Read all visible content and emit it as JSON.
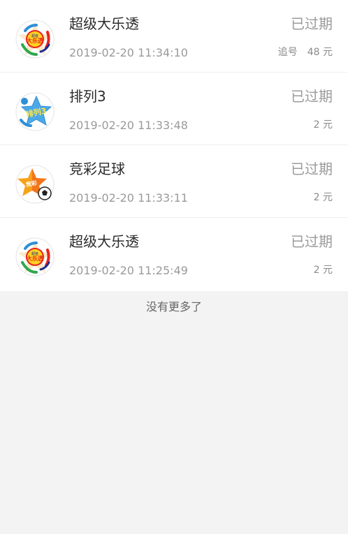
{
  "records": [
    {
      "name": "超级大乐透",
      "logo": "daletou-logo-icon",
      "logo_text": "大乐透",
      "logo_small": "超级",
      "time": "2019-02-20 11:34:10",
      "status": "已过期",
      "tag": "追号",
      "amount": "48 元"
    },
    {
      "name": "排列3",
      "logo": "pailie3-logo-icon",
      "logo_text": "排列3",
      "time": "2019-02-20 11:33:48",
      "status": "已过期",
      "tag": "",
      "amount": "2 元"
    },
    {
      "name": "竞彩足球",
      "logo": "jingcai-football-logo-icon",
      "logo_text": "竞彩",
      "time": "2019-02-20 11:33:11",
      "status": "已过期",
      "tag": "",
      "amount": "2 元"
    },
    {
      "name": "超级大乐透",
      "logo": "daletou-logo-icon",
      "logo_text": "大乐透",
      "logo_small": "超级",
      "time": "2019-02-20 11:25:49",
      "status": "已过期",
      "tag": "",
      "amount": "2 元"
    }
  ],
  "footer": {
    "no_more_text": "没有更多了"
  },
  "colors": {
    "page_background": "#f3f3f3",
    "card_background": "#ffffff",
    "title_text": "#2b2b2b",
    "secondary_text": "#9a9a9a",
    "logo_red": "#e8231e",
    "logo_orange": "#f7a21b",
    "logo_blue": "#2e8fd6",
    "logo_green": "#2fa84f",
    "logo_yellow": "#ffd21f"
  }
}
